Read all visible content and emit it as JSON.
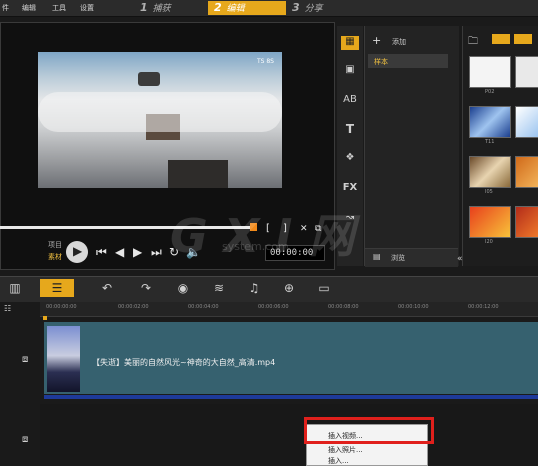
{
  "menu": {
    "file": "件",
    "edit": "编辑",
    "tools": "工具",
    "settings": "设置"
  },
  "steps": [
    {
      "num": "1",
      "label": "捕获"
    },
    {
      "num": "2",
      "label": "编辑"
    },
    {
      "num": "3",
      "label": "分享"
    }
  ],
  "preview": {
    "mode_project": "项目",
    "mode_clip": "素材",
    "bracket_left": "[",
    "bracket_right": "]",
    "timecode": "00:00:00",
    "overlay_text": "TS 8S"
  },
  "library": {
    "add_label": "添加",
    "sample_label": "样本",
    "browse_label": "浏览",
    "thumbs": [
      {
        "label": "P02"
      },
      {
        "label": ""
      },
      {
        "label": "T11"
      },
      {
        "label": ""
      },
      {
        "label": "I05"
      },
      {
        "label": ""
      },
      {
        "label": "I20"
      },
      {
        "label": ""
      }
    ]
  },
  "timeline": {
    "ruler": [
      "00:00:00:00",
      "00:00:02:00",
      "00:00:04:00",
      "00:00:06:00",
      "00:00:08:00",
      "00:00:10:00",
      "00:00:12:00"
    ],
    "clip_name": "【失逝】美丽的自然风光~神奇的大自然_高清.mp4",
    "context_menu": [
      "插入视频...",
      "插入照片...",
      "插入..."
    ]
  },
  "watermark": {
    "main": "G X I 网",
    "sub": "system.com"
  },
  "colors": {
    "accent": "#e6a81c",
    "clip": "#36616f",
    "highlight": "#e0201c"
  }
}
